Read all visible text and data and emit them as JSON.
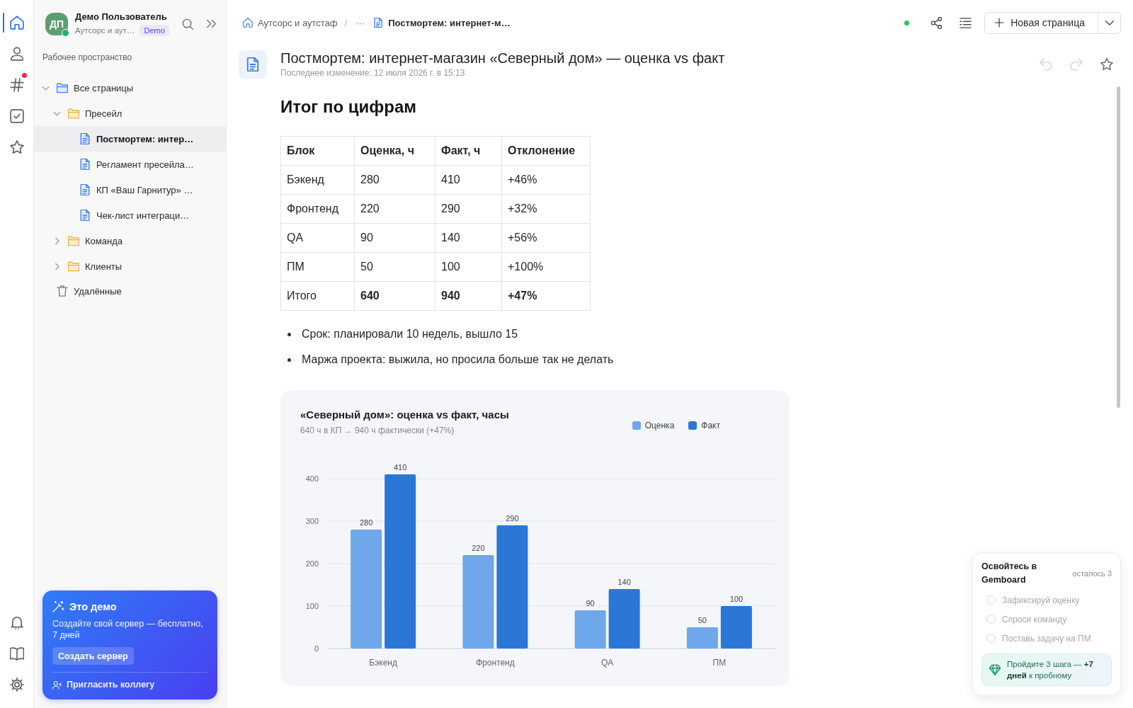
{
  "rail": {
    "items": [
      {
        "kind": "home",
        "selected": true,
        "unread": false
      },
      {
        "kind": "contacts",
        "selected": false,
        "unread": false
      },
      {
        "kind": "channels",
        "selected": false,
        "unread": true
      },
      {
        "kind": "tasks",
        "selected": false,
        "unread": false
      },
      {
        "kind": "favorites",
        "selected": false,
        "unread": false
      }
    ],
    "bottom_items": [
      {
        "kind": "notifications",
        "selected": false,
        "unread": false
      },
      {
        "kind": "docs",
        "selected": false,
        "unread": false
      },
      {
        "kind": "settings",
        "selected": false,
        "unread": false
      }
    ]
  },
  "sidebar": {
    "user": {
      "initials": "ДП",
      "name": "Демо Пользователь",
      "workspace": "Аутсорс и аут…",
      "badge": "Demo",
      "online": true
    },
    "section_title": "Рабочее пространство",
    "tree": [
      {
        "label": "Все страницы",
        "kind": "folder",
        "expanded": true,
        "selected": false,
        "children": [
          {
            "label": "Пресейл",
            "kind": "folder",
            "expanded": true,
            "selected": false,
            "children": [
              {
                "label": "Постмортем: интер…",
                "kind": "page",
                "selected": true
              },
              {
                "label": "Регламент пресейла…",
                "kind": "page",
                "selected": false
              },
              {
                "label": "КП «Ваш Гарнитур» …",
                "kind": "page",
                "selected": false
              },
              {
                "label": "Чек-лист интеграци…",
                "kind": "page",
                "selected": false
              }
            ]
          },
          {
            "label": "Команда",
            "kind": "folder",
            "expanded": false,
            "selected": false
          },
          {
            "label": "Клиенты",
            "kind": "folder",
            "expanded": false,
            "selected": false
          }
        ]
      },
      {
        "label": "Удалённые",
        "kind": "trash",
        "selected": false
      }
    ],
    "promo": {
      "title": "Это демо",
      "text": "Создайте свой сервер — бесплатно, 7 дней",
      "button": "Создать сервер",
      "invite": "Пригласить коллегу"
    }
  },
  "topbar": {
    "breadcrumbs": [
      {
        "kind": "space",
        "label": "Аутсорс и аутстаф"
      },
      {
        "kind": "separator",
        "label": "/"
      },
      {
        "kind": "more",
        "label": "···"
      },
      {
        "kind": "page",
        "label": "Постмортем: интернет-м…"
      }
    ],
    "connected": true,
    "new_page_button": "Новая страница"
  },
  "document": {
    "title": "Постмортем: интернет-магазин «Северный дом» — оценка vs факт",
    "meta": "Последнее изменение: 12 июля 2026 г. в 15:13",
    "can_undo": false,
    "can_redo": false,
    "starred": false,
    "heading": "Итог по цифрам",
    "table": {
      "columns": [
        "Блок",
        "Оценка, ч",
        "Факт, ч",
        "Отклонение"
      ],
      "rows": [
        {
          "cells": [
            "Бэкенд",
            "280",
            "410",
            "+46%"
          ],
          "total": false
        },
        {
          "cells": [
            "Фронтенд",
            "220",
            "290",
            "+32%"
          ],
          "total": false
        },
        {
          "cells": [
            "QA",
            "90",
            "140",
            "+56%"
          ],
          "total": false
        },
        {
          "cells": [
            "ПМ",
            "50",
            "100",
            "+100%"
          ],
          "total": false
        },
        {
          "cells": [
            "Итого",
            "640",
            "940",
            "+47%"
          ],
          "total": true
        }
      ]
    },
    "bullets": [
      "Срок: планировали 10 недель, вышло 15",
      "Маржа проекта: выжила, но просила больше так не делать"
    ],
    "chart": {
      "subtitle": "640 ч в КП → 940 ч фактически (+47%)",
      "chart_data": {
        "type": "bar",
        "title": "«Северный дом»: оценка vs факт, часы",
        "categories": [
          "Бэкенд",
          "Фронтенд",
          "QA",
          "ПМ"
        ],
        "series": [
          {
            "name": "Оценка",
            "color": "#6ea7ea",
            "values": [
              280,
              220,
              90,
              50
            ]
          },
          {
            "name": "Факт",
            "color": "#2a77d5",
            "values": [
              410,
              290,
              140,
              100
            ]
          }
        ],
        "ylim": [
          0,
          410
        ],
        "yticks": [
          0,
          100,
          200,
          300,
          400
        ],
        "grid": true,
        "legend": true,
        "data_labels": true
      }
    }
  },
  "onboarding": {
    "title": "Освойтесь в Gemboard",
    "remaining": "осталось 3",
    "steps": [
      {
        "label": "Зафиксируй оценку",
        "done": false
      },
      {
        "label": "Спроси команду",
        "done": false
      },
      {
        "label": "Поставь задачу на ПМ",
        "done": false
      }
    ],
    "reward": "Пройдите 3 шага — **+7 дней** к пробному"
  }
}
